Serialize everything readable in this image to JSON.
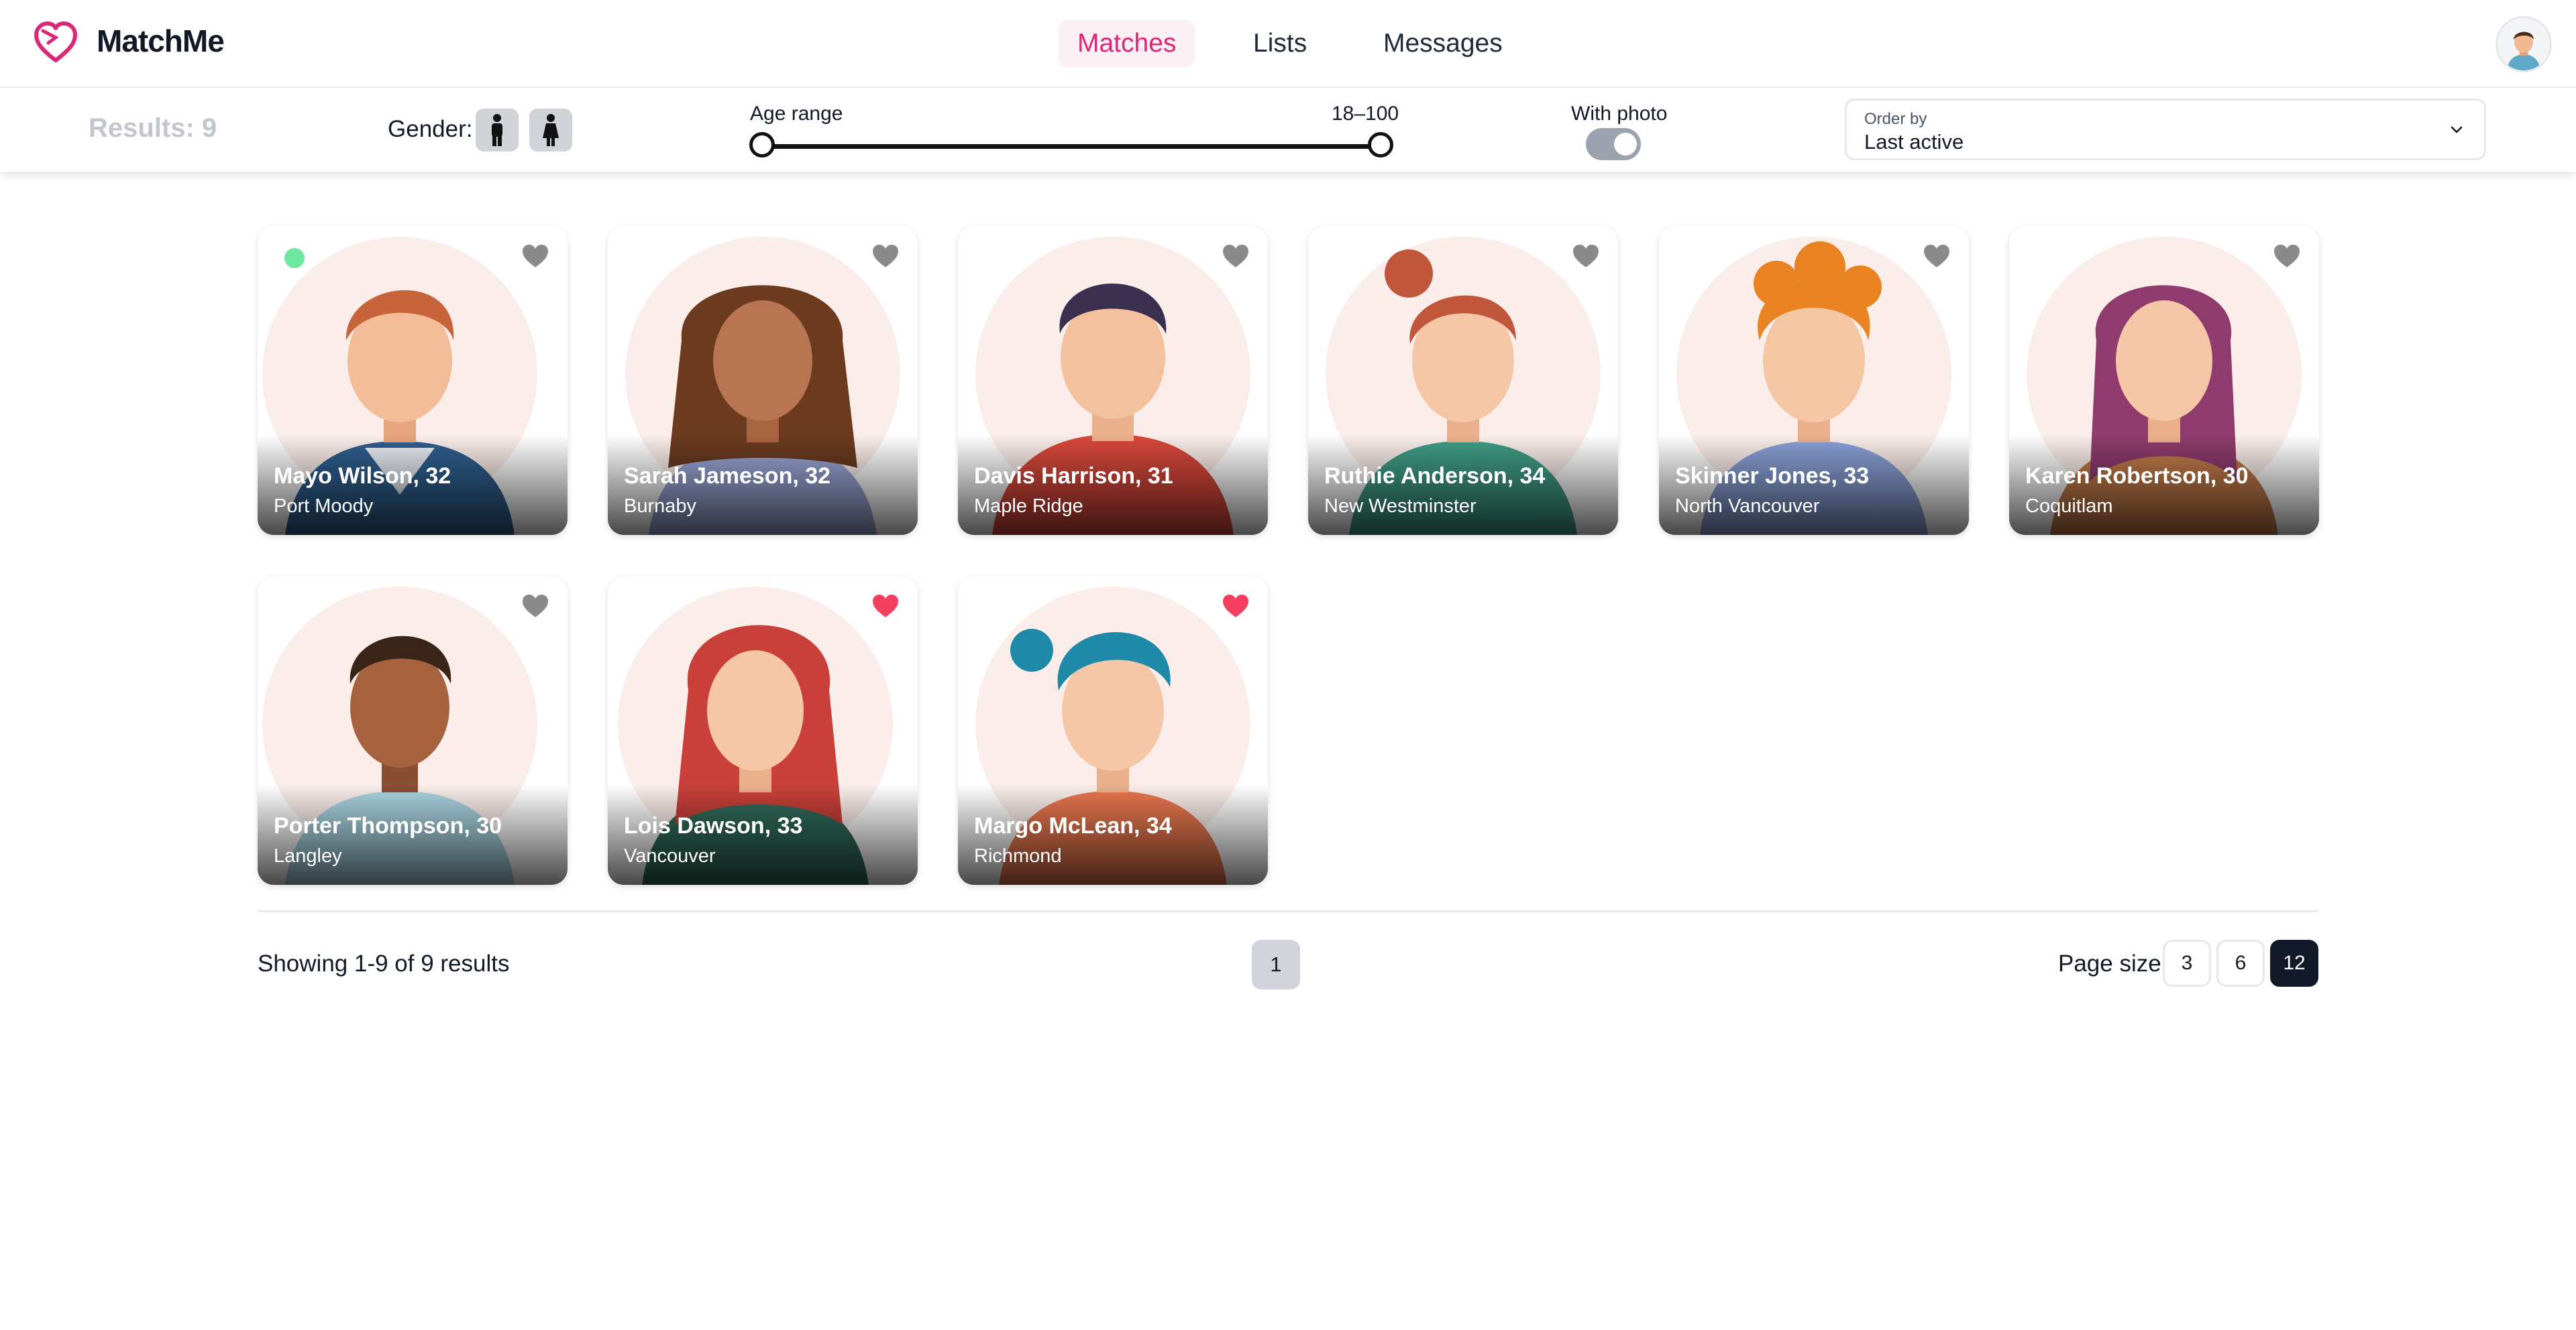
{
  "app": {
    "name": "MatchMe"
  },
  "nav": {
    "items": [
      {
        "label": "Matches",
        "active": true
      },
      {
        "label": "Lists",
        "active": false
      },
      {
        "label": "Messages",
        "active": false
      }
    ]
  },
  "filters": {
    "results": "Results: 9",
    "gender_label": "Gender:",
    "gender_options": [
      "male-icon",
      "female-icon"
    ],
    "age_label": "Age range",
    "age_value": "18–100",
    "age_min": 18,
    "age_max": 100,
    "photo_label": "With photo",
    "with_photo": true,
    "order_label": "Order by",
    "order_value": "Last active"
  },
  "members": [
    {
      "name": "Mayo Wilson, 32",
      "city": "Port Moody",
      "liked": false,
      "online": true
    },
    {
      "name": "Sarah Jameson, 32",
      "city": "Burnaby",
      "liked": false,
      "online": false
    },
    {
      "name": "Davis Harrison, 31",
      "city": "Maple Ridge",
      "liked": false,
      "online": false
    },
    {
      "name": "Ruthie Anderson, 34",
      "city": "New Westminster",
      "liked": false,
      "online": false
    },
    {
      "name": "Skinner Jones, 33",
      "city": "North Vancouver",
      "liked": false,
      "online": false
    },
    {
      "name": "Karen Robertson, 30",
      "city": "Coquitlam",
      "liked": false,
      "online": false
    },
    {
      "name": "Porter Thompson, 30",
      "city": "Langley",
      "liked": false,
      "online": false
    },
    {
      "name": "Lois Dawson, 33",
      "city": "Vancouver",
      "liked": true,
      "online": false
    },
    {
      "name": "Margo McLean, 34",
      "city": "Richmond",
      "liked": true,
      "online": false
    }
  ],
  "pagination": {
    "showing": "Showing 1-9 of 9 results",
    "pages": [
      "1"
    ],
    "page_size_label": "Page size:",
    "page_sizes": [
      "3",
      "6",
      "12"
    ],
    "selected_page_size": "12"
  },
  "colors": {
    "accent": "#db2777",
    "heart_liked": "#f43f5e",
    "heart_default": "#9ca3af",
    "online": "#6ee7a0"
  }
}
